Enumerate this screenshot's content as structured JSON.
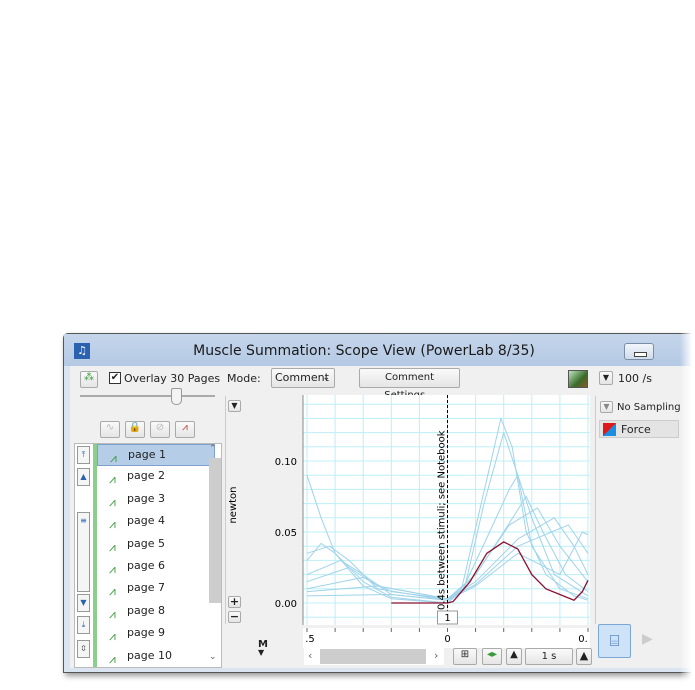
{
  "window": {
    "title": "Muscle Summation: Scope View (PowerLab 8/35)"
  },
  "toolbar": {
    "overlay_checked": true,
    "overlay_label": "Overlay 30 Pages",
    "mode_label": "Mode:",
    "mode_value": "Comment",
    "comment_settings": "Comment Settings...",
    "rate_value": "100 /s"
  },
  "pages": [
    "page 1",
    "page 2",
    "page 3",
    "page 4",
    "page 5",
    "page 6",
    "page 7",
    "page 8",
    "page 9",
    "page 10"
  ],
  "selected_page": "page 1",
  "right_panel": {
    "sampling": "No Sampling",
    "channel": "Force"
  },
  "bottom": {
    "marker": "M",
    "timebase": "1 s",
    "comment_number": "1"
  },
  "chart_data": {
    "type": "line",
    "ylabel": "newton",
    "yticks": [
      "0.10",
      "0.05",
      "0.00"
    ],
    "xticks": [
      ".5",
      "0",
      "0."
    ],
    "xlim": [
      -0.5,
      0.5
    ],
    "ylim": [
      -0.01,
      0.145
    ],
    "comment_text": "0.4s between stimuli; see Notebook",
    "comment_x": 0,
    "grid": true,
    "colors": {
      "overlay": "#9fd3ea",
      "current": "#8b1030",
      "grid": "#bdeff5"
    },
    "current": [
      [
        -0.2,
        0
      ],
      [
        0,
        0
      ],
      [
        0.02,
        0.001
      ],
      [
        0.08,
        0.015
      ],
      [
        0.14,
        0.035
      ],
      [
        0.2,
        0.043
      ],
      [
        0.25,
        0.038
      ],
      [
        0.3,
        0.02
      ],
      [
        0.35,
        0.01
      ],
      [
        0.4,
        0.006
      ],
      [
        0.45,
        0.002
      ],
      [
        0.48,
        0.008
      ],
      [
        0.5,
        0.016
      ]
    ],
    "overlay": [
      [
        [
          -0.5,
          0.09
        ],
        [
          -0.45,
          0.06
        ],
        [
          -0.4,
          0.035
        ],
        [
          -0.3,
          0.012
        ],
        [
          -0.2,
          0.003
        ],
        [
          0,
          0
        ],
        [
          0.05,
          0.01
        ],
        [
          0.12,
          0.07
        ],
        [
          0.19,
          0.13
        ],
        [
          0.23,
          0.11
        ],
        [
          0.28,
          0.05
        ],
        [
          0.35,
          0.02
        ],
        [
          0.45,
          0.005
        ],
        [
          0.5,
          0.002
        ]
      ],
      [
        [
          -0.5,
          0.03
        ],
        [
          -0.45,
          0.042
        ],
        [
          -0.4,
          0.035
        ],
        [
          -0.3,
          0.015
        ],
        [
          -0.2,
          0.004
        ],
        [
          0,
          0
        ],
        [
          0.06,
          0.01
        ],
        [
          0.13,
          0.07
        ],
        [
          0.2,
          0.12
        ],
        [
          0.25,
          0.09
        ],
        [
          0.3,
          0.04
        ],
        [
          0.4,
          0.01
        ],
        [
          0.5,
          0.003
        ]
      ],
      [
        [
          -0.5,
          0.035
        ],
        [
          -0.42,
          0.04
        ],
        [
          -0.35,
          0.03
        ],
        [
          -0.25,
          0.01
        ],
        [
          0,
          0.002
        ],
        [
          0.05,
          0.008
        ],
        [
          0.15,
          0.05
        ],
        [
          0.22,
          0.08
        ],
        [
          0.25,
          0.09
        ],
        [
          0.3,
          0.06
        ],
        [
          0.38,
          0.02
        ],
        [
          0.5,
          0.005
        ]
      ],
      [
        [
          -0.5,
          0.02
        ],
        [
          -0.38,
          0.03
        ],
        [
          -0.3,
          0.02
        ],
        [
          -0.2,
          0.006
        ],
        [
          0,
          0.002
        ],
        [
          0.1,
          0.02
        ],
        [
          0.2,
          0.05
        ],
        [
          0.28,
          0.075
        ],
        [
          0.34,
          0.05
        ],
        [
          0.42,
          0.02
        ],
        [
          0.5,
          0.008
        ]
      ],
      [
        [
          -0.5,
          0.015
        ],
        [
          -0.35,
          0.025
        ],
        [
          -0.25,
          0.012
        ],
        [
          0,
          0.003
        ],
        [
          0.1,
          0.02
        ],
        [
          0.22,
          0.055
        ],
        [
          0.32,
          0.067
        ],
        [
          0.4,
          0.04
        ],
        [
          0.5,
          0.015
        ]
      ],
      [
        [
          -0.5,
          0.01
        ],
        [
          -0.3,
          0.018
        ],
        [
          -0.2,
          0.008
        ],
        [
          0,
          0.003
        ],
        [
          0.1,
          0.015
        ],
        [
          0.25,
          0.045
        ],
        [
          0.38,
          0.06
        ],
        [
          0.45,
          0.04
        ],
        [
          0.5,
          0.02
        ]
      ],
      [
        [
          -0.5,
          0.008
        ],
        [
          -0.25,
          0.012
        ],
        [
          0,
          0.003
        ],
        [
          0.1,
          0.013
        ],
        [
          0.25,
          0.04
        ],
        [
          0.43,
          0.055
        ],
        [
          0.5,
          0.035
        ]
      ],
      [
        [
          -0.5,
          0.005
        ],
        [
          -0.2,
          0.006
        ],
        [
          0,
          0.002
        ],
        [
          0.1,
          0.012
        ],
        [
          0.25,
          0.035
        ],
        [
          0.4,
          0.02
        ],
        [
          0.48,
          0.05
        ],
        [
          0.5,
          0.048
        ]
      ]
    ]
  }
}
